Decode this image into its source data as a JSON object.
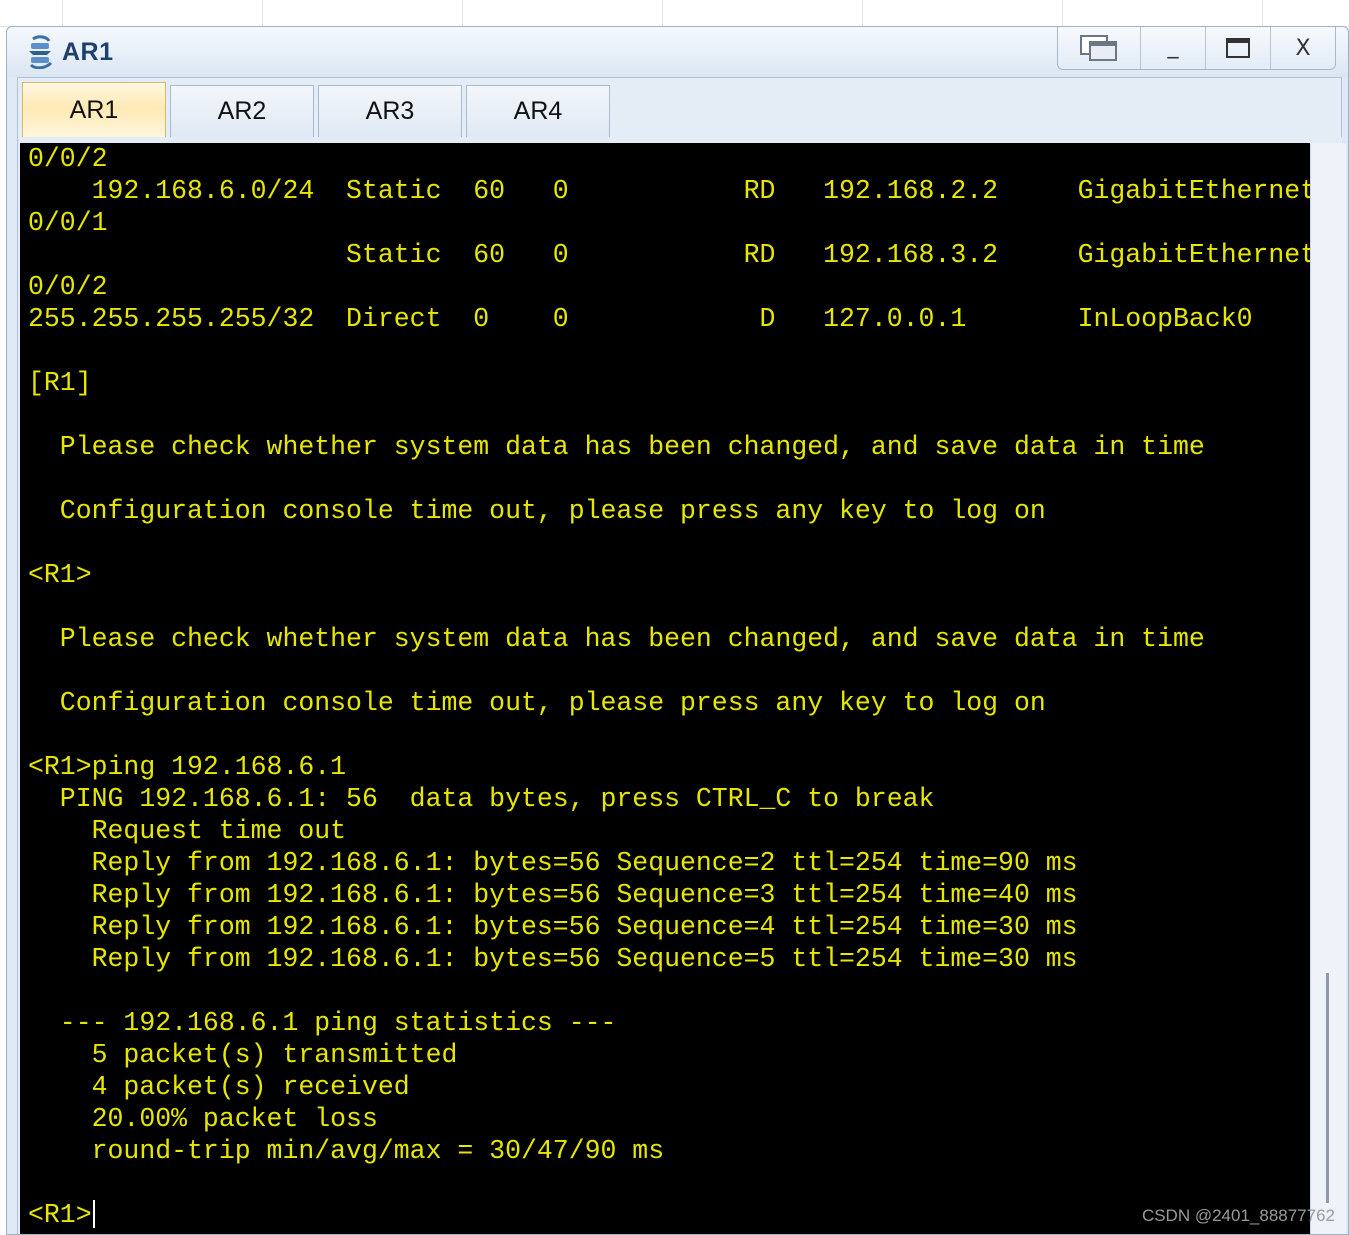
{
  "window": {
    "title": "AR1",
    "controls": {
      "restore_icon": "restore-window-icon",
      "minimize_label": "_",
      "maximize_icon": "maximize-icon",
      "close_label": "X"
    }
  },
  "tabs": [
    {
      "label": "AR1",
      "active": true
    },
    {
      "label": "AR2",
      "active": false
    },
    {
      "label": "AR3",
      "active": false
    },
    {
      "label": "AR4",
      "active": false
    }
  ],
  "console": {
    "text_color": "#e6e600",
    "background": "#000000",
    "lines": [
      "0/0/2",
      "    192.168.6.0/24  Static  60   0           RD   192.168.2.2     GigabitEthernet",
      "0/0/1",
      "                    Static  60   0           RD   192.168.3.2     GigabitEthernet",
      "0/0/2",
      "255.255.255.255/32  Direct  0    0            D   127.0.0.1       InLoopBack0",
      "",
      "[R1]",
      "",
      "  Please check whether system data has been changed, and save data in time",
      "",
      "  Configuration console time out, please press any key to log on",
      "",
      "<R1>",
      "",
      "  Please check whether system data has been changed, and save data in time",
      "",
      "  Configuration console time out, please press any key to log on",
      "",
      "<R1>ping 192.168.6.1",
      "  PING 192.168.6.1: 56  data bytes, press CTRL_C to break",
      "    Request time out",
      "    Reply from 192.168.6.1: bytes=56 Sequence=2 ttl=254 time=90 ms",
      "    Reply from 192.168.6.1: bytes=56 Sequence=3 ttl=254 time=40 ms",
      "    Reply from 192.168.6.1: bytes=56 Sequence=4 ttl=254 time=30 ms",
      "    Reply from 192.168.6.1: bytes=56 Sequence=5 ttl=254 time=30 ms",
      "",
      "  --- 192.168.6.1 ping statistics ---",
      "    5 packet(s) transmitted",
      "    4 packet(s) received",
      "    20.00% packet loss",
      "    round-trip min/avg/max = 30/47/90 ms",
      "",
      "<R1>"
    ]
  },
  "watermark": "CSDN @2401_88877762"
}
